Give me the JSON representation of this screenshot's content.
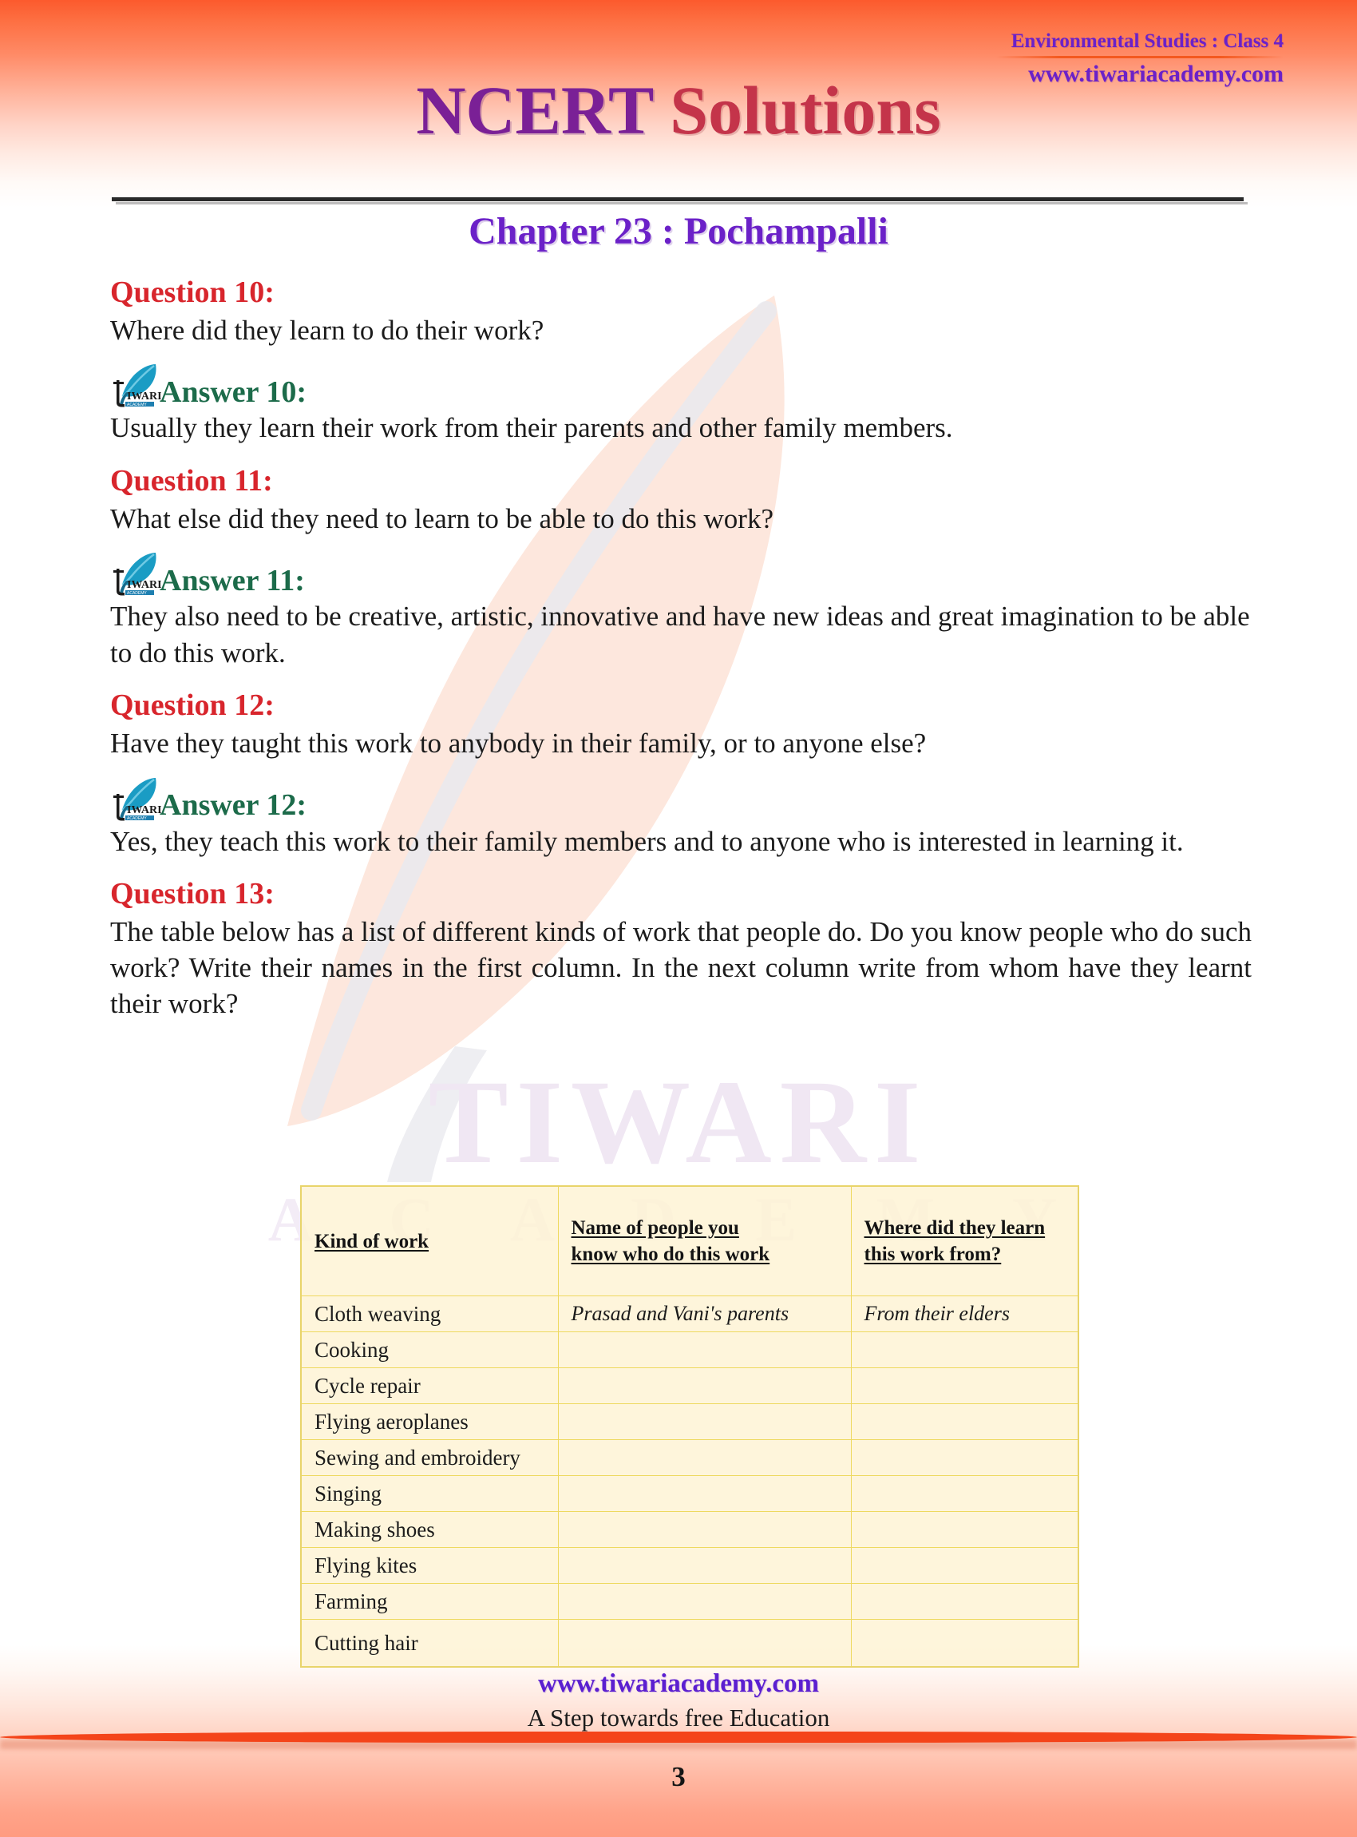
{
  "header": {
    "subject": "Environmental Studies : Class 4",
    "website": "www.tiwariacademy.com",
    "title_part1": "NCERT ",
    "title_part2": "Solutions",
    "chapter": "Chapter 23 : Pochampalli"
  },
  "watermark": {
    "line1": "TIWARI",
    "line2": "A C A D E M Y",
    "feather_name": "feather-quill-watermark"
  },
  "qa": [
    {
      "question_label": "Question 10:",
      "question_text": "Where did they learn to do their work?",
      "answer_label": "Answer 10:",
      "answer_text": "Usually they learn their work from their parents and other family members."
    },
    {
      "question_label": "Question 11:",
      "question_text": "What else did they need to learn to be able to do this work?",
      "answer_label": "Answer 11:",
      "answer_text": "They also need to be creative, artistic, innovative and have new ideas and great imagination to be able to do this work."
    },
    {
      "question_label": "Question 12:",
      "question_text": "Have they taught this work to anybody in their family, or to anyone else?",
      "answer_label": "Answer 12:",
      "answer_text": "Yes, they teach this work to their family members and to anyone who is interested in learning it."
    },
    {
      "question_label": "Question 13:",
      "question_text": "The table below has a list of different kinds of work that people do. Do you know people who do such work? Write their names in the first column. In the next column write from whom have they learnt their work?",
      "answer_label": "",
      "answer_text": ""
    }
  ],
  "table": {
    "headers": [
      {
        "line1": "Kind of work",
        "line2": ""
      },
      {
        "line1": "Name of people you",
        "line2": "know who do this work"
      },
      {
        "line1": "Where did they learn",
        "line2": "this work from?"
      }
    ],
    "rows": [
      {
        "kind": "Cloth weaving",
        "who": "Prasad and Vani's parents",
        "where": "From their elders"
      },
      {
        "kind": "Cooking",
        "who": "",
        "where": ""
      },
      {
        "kind": "Cycle repair",
        "who": "",
        "where": ""
      },
      {
        "kind": "Flying aeroplanes",
        "who": "",
        "where": ""
      },
      {
        "kind": "Sewing and embroidery",
        "who": "",
        "where": ""
      },
      {
        "kind": "Singing",
        "who": "",
        "where": ""
      },
      {
        "kind": "Making shoes",
        "who": "",
        "where": ""
      },
      {
        "kind": "Flying kites",
        "who": "",
        "where": ""
      },
      {
        "kind": "Farming",
        "who": "",
        "where": ""
      },
      {
        "kind": "Cutting hair",
        "who": "",
        "where": ""
      }
    ]
  },
  "footer": {
    "website": "www.tiwariacademy.com",
    "tagline": "A Step towards free Education",
    "page_number": "3"
  },
  "colors": {
    "question_red": "#d8252c",
    "answer_green": "#1c6b4a",
    "header_purple": "#6b21c8",
    "title_purple": "#7a2096",
    "title_red": "#c4344a",
    "table_border": "#eed95f",
    "table_fill": "#fdf3d4",
    "band_orange": "#fc5a2d"
  }
}
